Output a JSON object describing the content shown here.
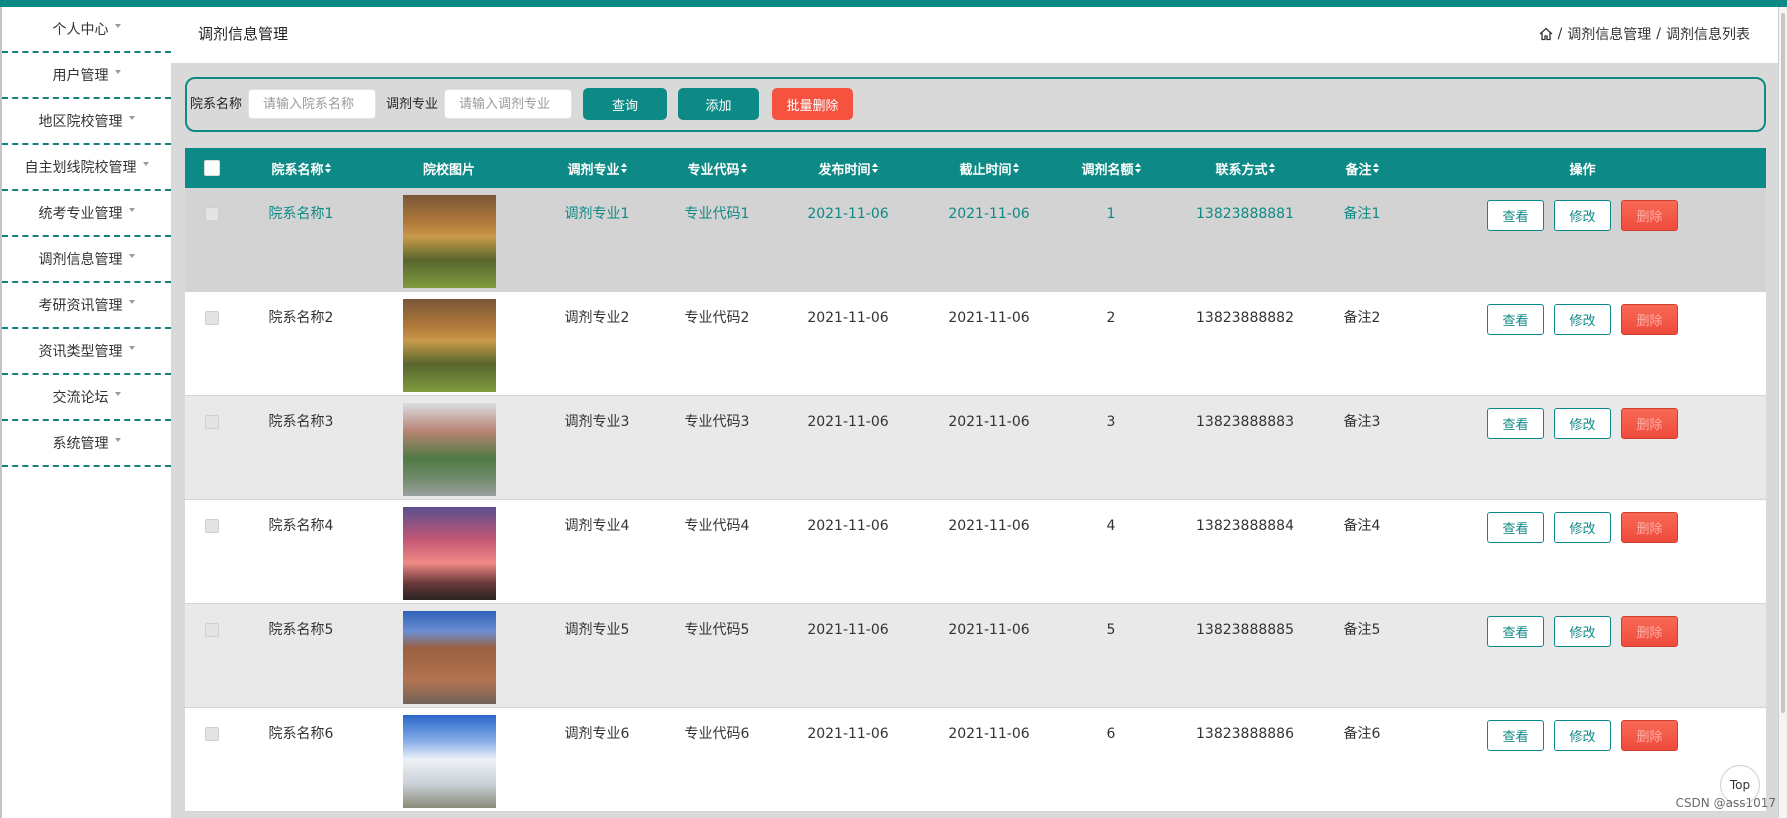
{
  "colors": {
    "accent": "#0e8a86",
    "danger": "#f5533f"
  },
  "sidebar": {
    "items": [
      "个人中心",
      "用户管理",
      "地区院校管理",
      "自主划线院校管理",
      "统考专业管理",
      "调剂信息管理",
      "考研资讯管理",
      "资讯类型管理",
      "交流论坛",
      "系统管理"
    ]
  },
  "header": {
    "title": "调剂信息管理",
    "breadcrumb": {
      "separator": "/",
      "items": [
        "调剂信息管理",
        "调剂信息列表"
      ]
    }
  },
  "search": {
    "fields": [
      {
        "label": "院系名称",
        "placeholder": "请输入院系名称"
      },
      {
        "label": "调剂专业",
        "placeholder": "请输入调剂专业"
      }
    ],
    "buttons": {
      "query": "查询",
      "add": "添加",
      "batch_delete": "批量删除"
    }
  },
  "table": {
    "columns": [
      "院系名称",
      "院校图片",
      "调剂专业",
      "专业代码",
      "发布时间",
      "截止时间",
      "调剂名额",
      "联系方式",
      "备注",
      "操作"
    ],
    "rows": [
      {
        "college_name": "院系名称1",
        "major": "调剂专业1",
        "major_code": "专业代码1",
        "publish_date": "2021-11-06",
        "deadline": "2021-11-06",
        "quota": "1",
        "contact": "13823888881",
        "remark": "备注1"
      },
      {
        "college_name": "院系名称2",
        "major": "调剂专业2",
        "major_code": "专业代码2",
        "publish_date": "2021-11-06",
        "deadline": "2021-11-06",
        "quota": "2",
        "contact": "13823888882",
        "remark": "备注2"
      },
      {
        "college_name": "院系名称3",
        "major": "调剂专业3",
        "major_code": "专业代码3",
        "publish_date": "2021-11-06",
        "deadline": "2021-11-06",
        "quota": "3",
        "contact": "13823888883",
        "remark": "备注3"
      },
      {
        "college_name": "院系名称4",
        "major": "调剂专业4",
        "major_code": "专业代码4",
        "publish_date": "2021-11-06",
        "deadline": "2021-11-06",
        "quota": "4",
        "contact": "13823888884",
        "remark": "备注4"
      },
      {
        "college_name": "院系名称5",
        "major": "调剂专业5",
        "major_code": "专业代码5",
        "publish_date": "2021-11-06",
        "deadline": "2021-11-06",
        "quota": "5",
        "contact": "13823888885",
        "remark": "备注5"
      },
      {
        "college_name": "院系名称6",
        "major": "调剂专业6",
        "major_code": "专业代码6",
        "publish_date": "2021-11-06",
        "deadline": "2021-11-06",
        "quota": "6",
        "contact": "13823888886",
        "remark": "备注6"
      }
    ],
    "actions": {
      "view": "查看",
      "edit": "修改",
      "delete": "删除"
    }
  },
  "top_button": "Top",
  "watermark": "CSDN @ass1017"
}
